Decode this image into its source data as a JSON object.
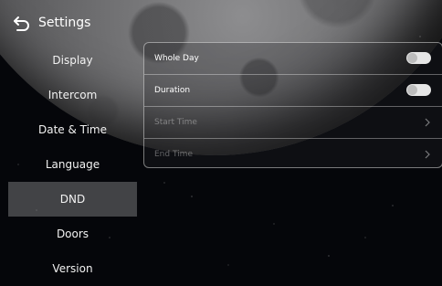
{
  "header": {
    "title": "Settings",
    "back_icon": "back-arrow-icon"
  },
  "sidebar": {
    "items": [
      {
        "label": "Display"
      },
      {
        "label": "Intercom"
      },
      {
        "label": "Date & Time"
      },
      {
        "label": "Language"
      },
      {
        "label": "DND",
        "active": true
      },
      {
        "label": "Doors"
      },
      {
        "label": "Version"
      }
    ]
  },
  "dnd": {
    "whole_day": {
      "label": "Whole Day",
      "enabled": false
    },
    "duration": {
      "label": "Duration",
      "enabled": false
    },
    "start_time": {
      "label": "Start Time",
      "disabled": true
    },
    "end_time": {
      "label": "End Time",
      "disabled": true
    }
  },
  "colors": {
    "active_item_bg": "#69696c",
    "toggle_track": "#e6e6e6"
  }
}
